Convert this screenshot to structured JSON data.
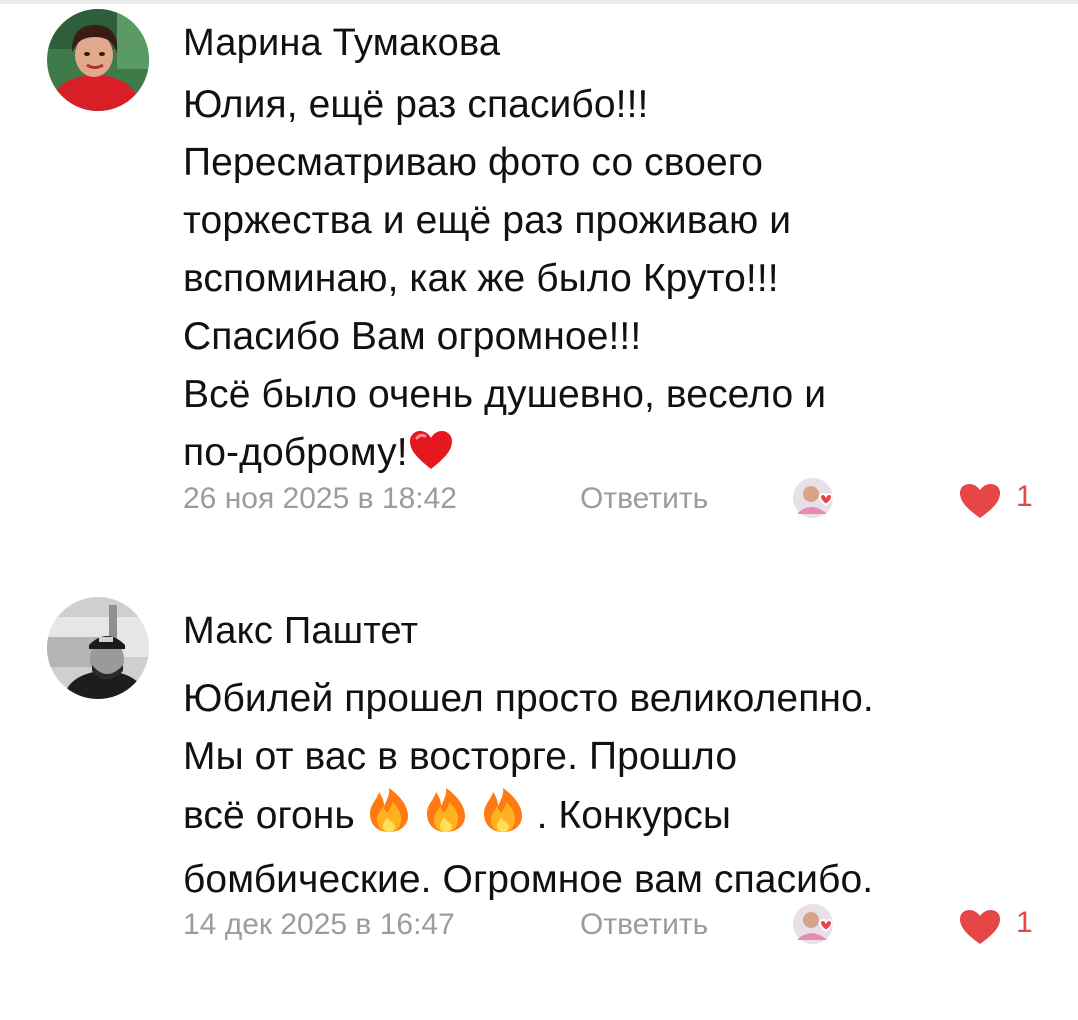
{
  "comments": [
    {
      "author": "Марина Тумакова",
      "avatar_icon": "user-avatar-woman",
      "text_lines": [
        "Юлия, ещё раз спасибо!!!",
        "Пересматриваю фото со своего",
        "торжества и ещё раз проживаю и",
        "вспоминаю, как же было Круто!!!",
        "Спасибо Вам огромное!!!",
        "Всё было очень душевно, весело и",
        "по-доброму!"
      ],
      "trailing_emoji": "heart-emoji",
      "date": "26 ноя 2025 в 18:42",
      "reply_label": "Ответить",
      "like_count": "1"
    },
    {
      "author": "Макс Паштет",
      "avatar_icon": "user-avatar-man",
      "text_lines": [
        "Юбилей прошел просто великолепно.",
        "Мы от вас в восторге. Прошло",
        "всё огонь",
        ". Конкурсы",
        "бомбические. Огромное вам спасибо."
      ],
      "inline_emoji": "fire-emoji",
      "date": "14 дек 2025 в 16:47",
      "reply_label": "Ответить",
      "like_count": "1"
    }
  ],
  "colors": {
    "meta_gray": "#9a9ca0",
    "like_red": "#e64646",
    "text": "#111111"
  }
}
